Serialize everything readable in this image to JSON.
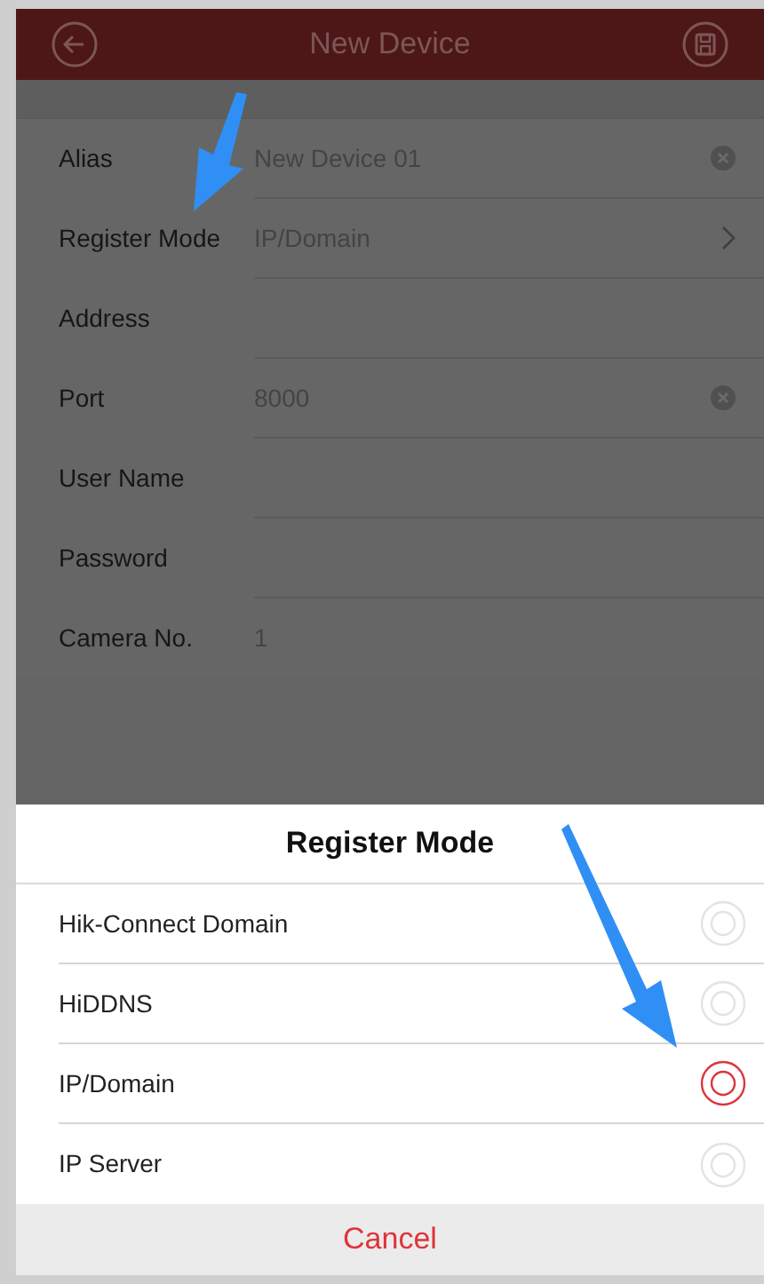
{
  "header": {
    "title": "New Device"
  },
  "form": {
    "rows": [
      {
        "label": "Alias",
        "value": "New Device 01",
        "kind": "clearable"
      },
      {
        "label": "Register Mode",
        "value": "IP/Domain",
        "kind": "picker"
      },
      {
        "label": "Address",
        "kind": "plain"
      },
      {
        "label": "Port",
        "value": "8000",
        "kind": "clearable"
      },
      {
        "label": "User Name",
        "kind": "plain"
      },
      {
        "label": "Password",
        "kind": "plain"
      },
      {
        "label": "Camera No.",
        "value": "1",
        "kind": "plain"
      }
    ]
  },
  "sheet": {
    "title": "Register Mode",
    "options": [
      {
        "label": "Hik-Connect Domain",
        "selected": false
      },
      {
        "label": "HiDDNS",
        "selected": false
      },
      {
        "label": "IP/Domain",
        "selected": true
      },
      {
        "label": "IP Server",
        "selected": false
      }
    ],
    "cancel": "Cancel"
  }
}
